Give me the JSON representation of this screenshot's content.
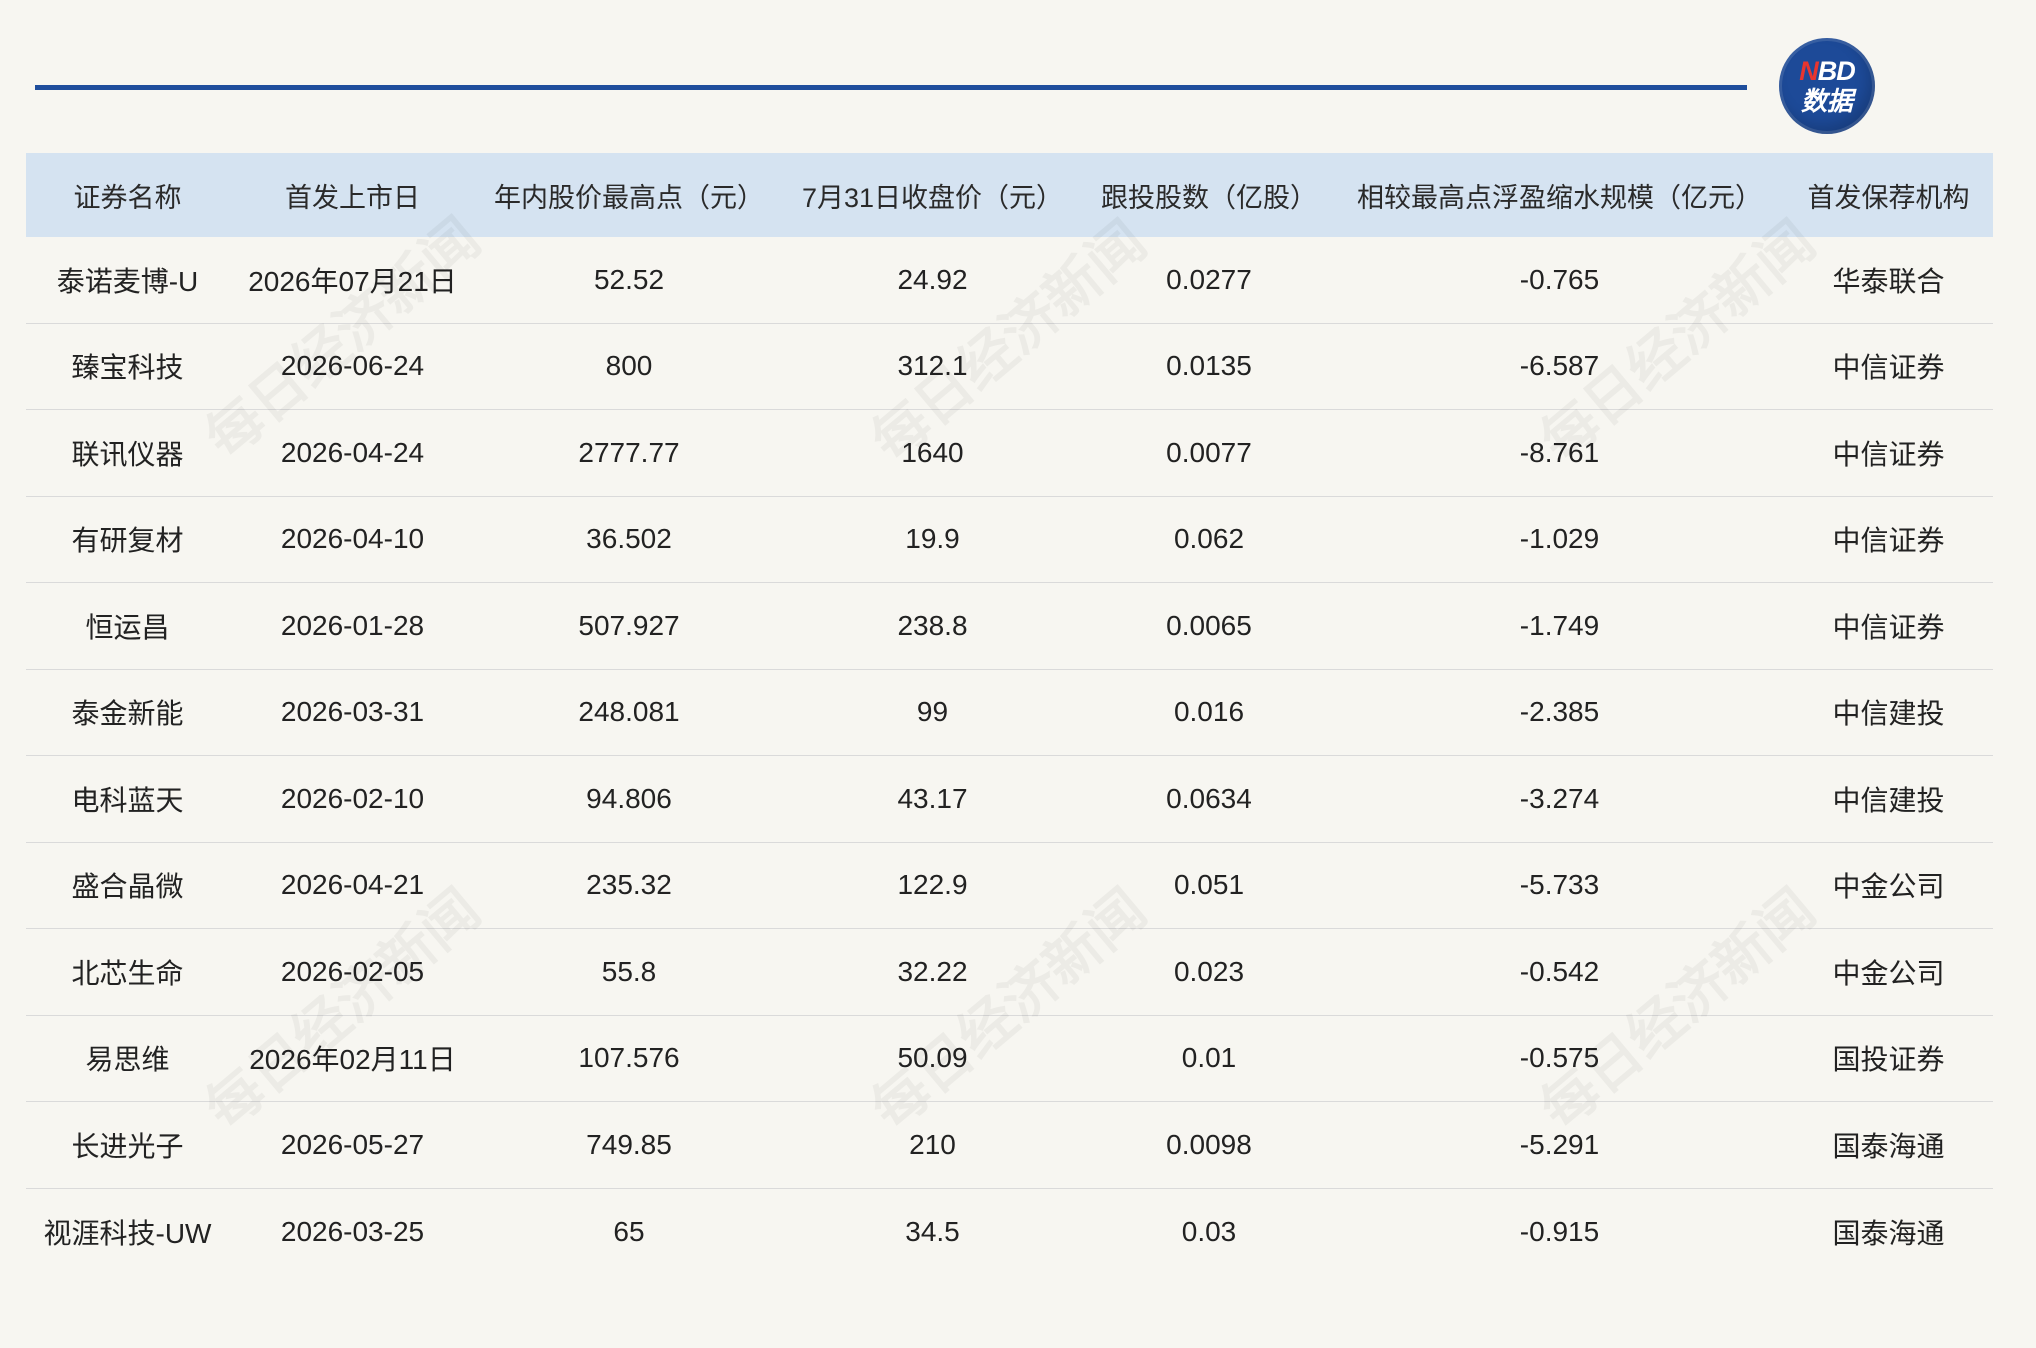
{
  "watermark": "每日经济新闻",
  "logo": {
    "mark_n": "N",
    "mark_bd": "BD",
    "label": "数据"
  },
  "colors": {
    "background": "#f7f6f1",
    "rule": "#1f4e9c",
    "header_bg": "#d5e3f1",
    "logo_bg": "#1d4a98",
    "logo_accent": "#e8352f",
    "text": "#222222",
    "row_border": "#dadada"
  },
  "chart_data": {
    "type": "table",
    "columns": [
      "证券名称",
      "首发上市日",
      "年内股价最高点（元）",
      "7月31日收盘价（元）",
      "跟投股数（亿股）",
      "相较最高点浮盈缩水规模（亿元）",
      "首发保荐机构"
    ],
    "rows": [
      [
        "泰诺麦博-U",
        "2026年07月21日",
        52.52,
        24.92,
        0.0277,
        -0.765,
        "华泰联合"
      ],
      [
        "臻宝科技",
        "2026-06-24",
        800,
        312.1,
        0.0135,
        -6.587,
        "中信证券"
      ],
      [
        "联讯仪器",
        "2026-04-24",
        2777.77,
        1640,
        0.0077,
        -8.761,
        "中信证券"
      ],
      [
        "有研复材",
        "2026-04-10",
        36.502,
        19.9,
        0.062,
        -1.029,
        "中信证券"
      ],
      [
        "恒运昌",
        "2026-01-28",
        507.927,
        238.8,
        0.0065,
        -1.749,
        "中信证券"
      ],
      [
        "泰金新能",
        "2026-03-31",
        248.081,
        99,
        0.016,
        -2.385,
        "中信建投"
      ],
      [
        "电科蓝天",
        "2026-02-10",
        94.806,
        43.17,
        0.0634,
        -3.274,
        "中信建投"
      ],
      [
        "盛合晶微",
        "2026-04-21",
        235.32,
        122.9,
        0.051,
        -5.733,
        "中金公司"
      ],
      [
        "北芯生命",
        "2026-02-05",
        55.8,
        32.22,
        0.023,
        -0.542,
        "中金公司"
      ],
      [
        "易思维",
        "2026年02月11日",
        107.576,
        50.09,
        0.01,
        -0.575,
        "国投证券"
      ],
      [
        "长进光子",
        "2026-05-27",
        749.85,
        210,
        0.0098,
        -5.291,
        "国泰海通"
      ],
      [
        "视涯科技-UW",
        "2026-03-25",
        65,
        34.5,
        0.03,
        -0.915,
        "国泰海通"
      ]
    ]
  }
}
